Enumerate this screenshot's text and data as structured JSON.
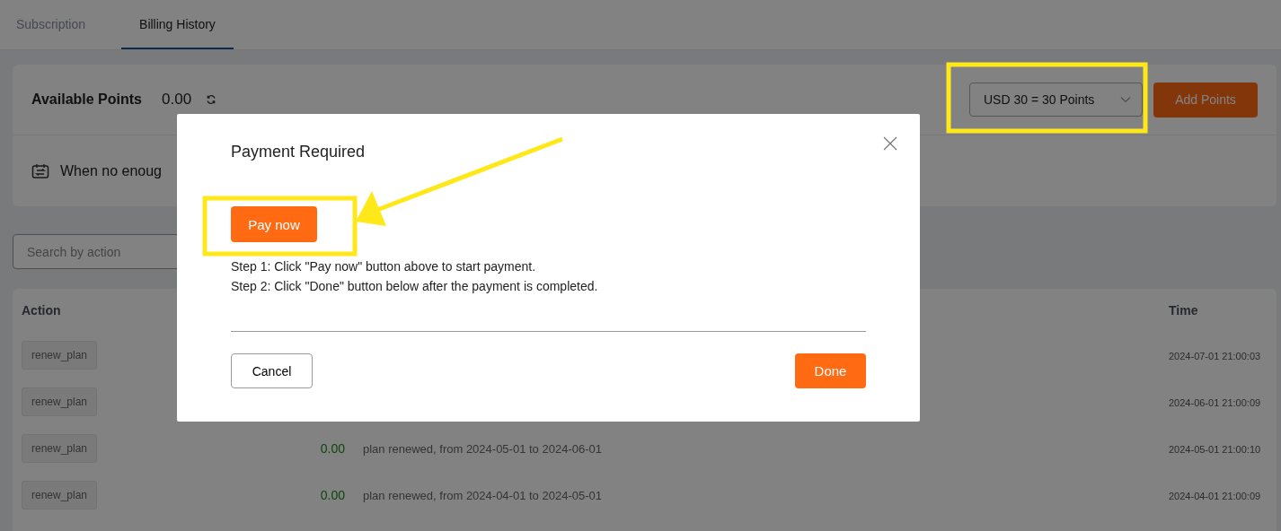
{
  "tabs": [
    {
      "label": "Subscription",
      "selected": false
    },
    {
      "label": "Billing History",
      "selected": true
    }
  ],
  "points": {
    "label": "Available Points",
    "value": "0.00"
  },
  "notice": "When no enoug",
  "package_select": {
    "value": "USD 30 = 30 Points"
  },
  "add_button": "Add Points",
  "search": {
    "placeholder": "Search by action"
  },
  "table": {
    "columns": [
      "Action",
      "Time"
    ],
    "rows": [
      {
        "action": "renew_plan",
        "time": "2024-07-01 21:00:03"
      },
      {
        "action": "renew_plan",
        "time": "2024-06-01 21:00:09"
      },
      {
        "action": "renew_plan",
        "amount": "0.00",
        "description": "plan renewed, from 2024-05-01 to 2024-06-01",
        "time": "2024-05-01 21:00:10"
      },
      {
        "action": "renew_plan",
        "amount": "0.00",
        "description": "plan renewed, from 2024-04-01 to 2024-05-01",
        "time": "2024-04-01 21:00:09"
      }
    ]
  },
  "modal": {
    "title": "Payment Required",
    "pay_button": "Pay now",
    "steps": [
      "Step 1: Click \"Pay now\" button above to start payment.",
      "Step 2: Click \"Done\" button below after the payment is completed."
    ],
    "cancel_button": "Cancel",
    "done_button": "Done"
  }
}
